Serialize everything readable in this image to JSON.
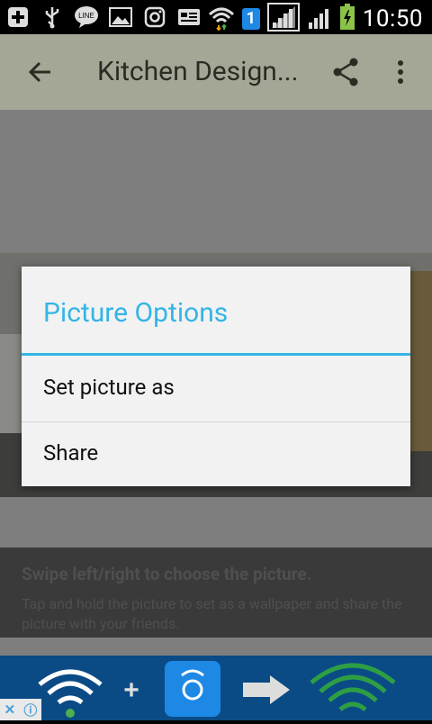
{
  "status_bar": {
    "time": "10:50",
    "sim_label": "1"
  },
  "app_bar": {
    "title": "Kitchen Design..."
  },
  "content": {
    "hint_title": "Swipe left/right to choose the picture.",
    "hint_body": "Tap and hold the picture to set as a wallpaper and share the picture with your friends."
  },
  "dialog": {
    "title": "Picture Options",
    "items": [
      {
        "label": "Set picture as"
      },
      {
        "label": "Share"
      }
    ]
  },
  "colors": {
    "accent": "#33b5e5",
    "app_bar": "#a5a796",
    "dialog_bg": "#f2f2f2",
    "ad_bg": "#0a4b86"
  }
}
